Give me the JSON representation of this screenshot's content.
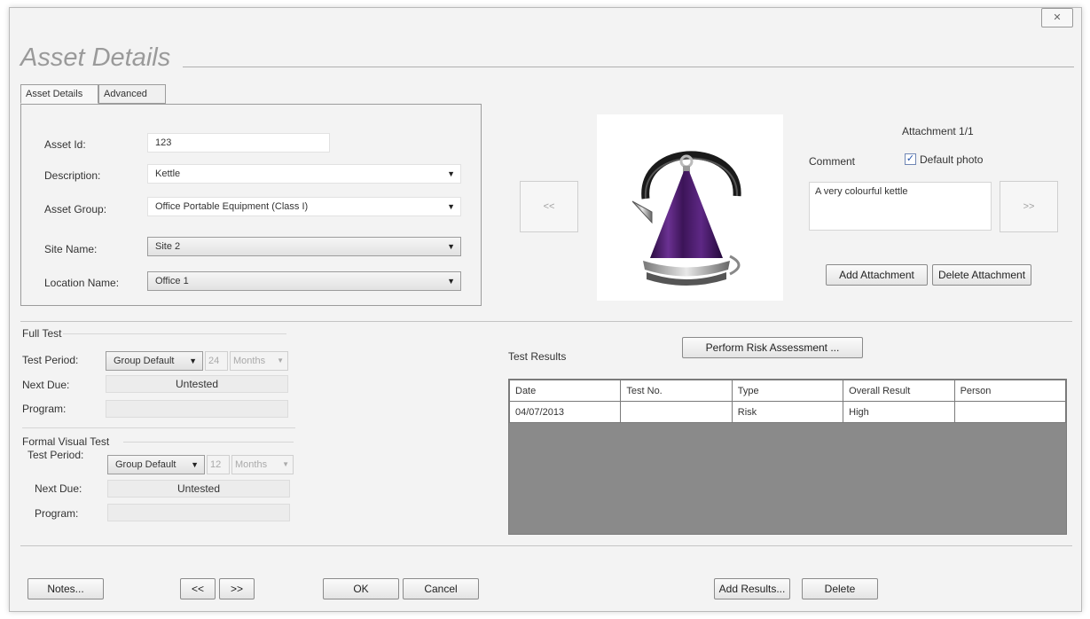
{
  "window": {
    "close_label": "✕",
    "title": "Asset Details"
  },
  "tabs": [
    {
      "label": "Asset Details"
    },
    {
      "label": "Advanced"
    }
  ],
  "asset": {
    "id_label": "Asset Id:",
    "id_value": "123",
    "description_label": "Description:",
    "description_value": "Kettle",
    "group_label": "Asset Group:",
    "group_value": "Office Portable Equipment (Class I)",
    "site_label": "Site Name:",
    "site_value": "Site 2",
    "location_label": "Location Name:",
    "location_value": "Office 1"
  },
  "attachment": {
    "counter": "Attachment 1/1",
    "comment_label": "Comment",
    "default_photo_label": "Default photo",
    "default_photo_checked": true,
    "comment_value": "A very colourful kettle",
    "prev_label": "<<",
    "next_label": ">>",
    "add_label": "Add Attachment",
    "delete_label": "Delete Attachment"
  },
  "full_test": {
    "title": "Full Test",
    "period_label": "Test Period:",
    "period_mode": "Group Default",
    "period_value": "24",
    "period_unit": "Months",
    "next_due_label": "Next Due:",
    "next_due_value": "Untested",
    "program_label": "Program:",
    "program_value": ""
  },
  "visual_test": {
    "title": "Formal Visual Test",
    "period_label": "Test Period:",
    "period_mode": "Group Default",
    "period_value": "12",
    "period_unit": "Months",
    "next_due_label": "Next Due:",
    "next_due_value": "Untested",
    "program_label": "Program:",
    "program_value": ""
  },
  "results": {
    "label": "Test Results",
    "risk_button": "Perform Risk Assessment ...",
    "columns": [
      "Date",
      "Test No.",
      "Type",
      "Overall Result",
      "Person"
    ],
    "rows": [
      [
        "04/07/2013",
        "",
        "Risk",
        "High",
        ""
      ]
    ]
  },
  "footer": {
    "notes": "Notes...",
    "prev": "<<",
    "next": ">>",
    "ok": "OK",
    "cancel": "Cancel",
    "add_results": "Add Results...",
    "delete": "Delete"
  },
  "icons": {
    "dropdown": "chevron-down-icon",
    "close": "close-icon",
    "check": "check-icon"
  },
  "colors": {
    "kettle_body": "#4a1c6e",
    "kettle_handle": "#1a1a1a",
    "grid_empty": "#8a8a8a"
  }
}
